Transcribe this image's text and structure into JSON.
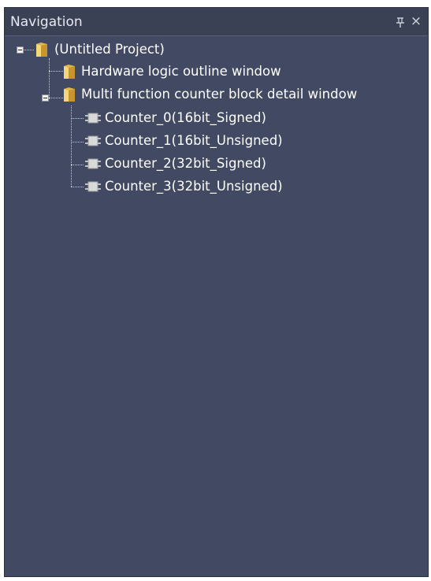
{
  "panel": {
    "title": "Navigation",
    "pin_glyph": "1",
    "pin_symbol": "ᵖ",
    "close_glyph": "×",
    "background_color": "#424a63",
    "text_color": "#ffffff"
  },
  "tree": {
    "root": {
      "label": "(Untitled Project)",
      "icon": "folder-icon",
      "expanded": true
    },
    "items": [
      {
        "label": "Hardware logic outline window",
        "icon": "folder-icon"
      },
      {
        "label": "Multi function counter block detail window",
        "icon": "folder-icon",
        "expanded": true
      }
    ],
    "counters": [
      {
        "label": "Counter_0(16bit_Signed)",
        "icon": "counter-chip-icon"
      },
      {
        "label": "Counter_1(16bit_Unsigned)",
        "icon": "counter-chip-icon"
      },
      {
        "label": "Counter_2(32bit_Signed)",
        "icon": "counter-chip-icon"
      },
      {
        "label": "Counter_3(32bit_Unsigned)",
        "icon": "counter-chip-icon"
      }
    ]
  }
}
